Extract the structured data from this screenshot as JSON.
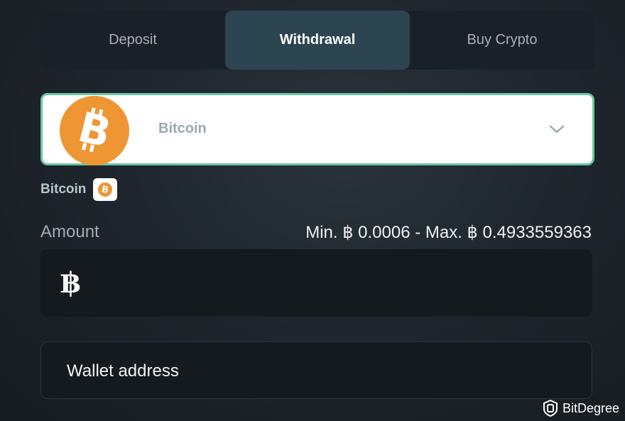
{
  "tabs": [
    {
      "label": "Deposit",
      "active": false
    },
    {
      "label": "Withdrawal",
      "active": true
    },
    {
      "label": "Buy Crypto",
      "active": false
    }
  ],
  "coin_select": {
    "selected": "Bitcoin",
    "icon": "bitcoin-icon"
  },
  "coin_label": "Bitcoin",
  "amount": {
    "label": "Amount",
    "limits": "Min. ฿ 0.0006 - Max. ฿ 0.4933559363",
    "currency_symbol": "฿"
  },
  "wallet": {
    "placeholder": "Wallet address"
  },
  "watermark": {
    "text": "BitDegree"
  },
  "colors": {
    "accent_border": "#69c7a4",
    "bitcoin_orange": "#ee9633",
    "active_tab": "#2c4550"
  }
}
